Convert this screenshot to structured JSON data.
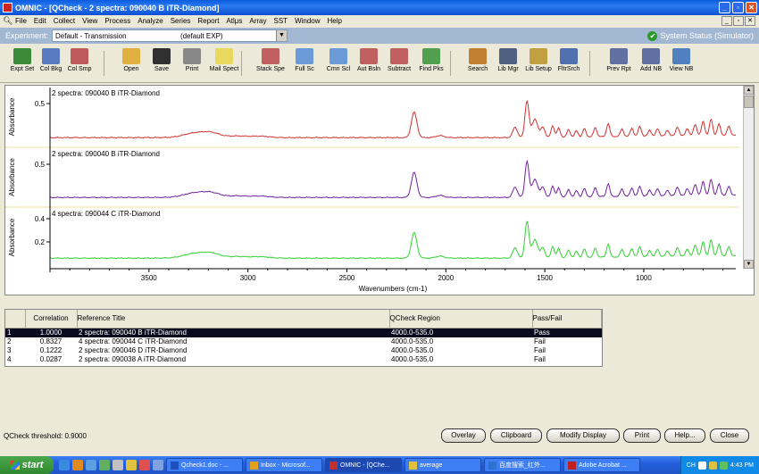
{
  "window": {
    "title": "OMNIC - [QCheck - 2 spectra: 090040 B   iTR-Diamond]",
    "controls": [
      "_",
      "▫",
      "✕"
    ]
  },
  "menu": {
    "items": [
      "File",
      "Edit",
      "Collect",
      "View",
      "Process",
      "Analyze",
      "Series",
      "Report",
      "Atlμs",
      "Array",
      "SST",
      "Window",
      "Help"
    ]
  },
  "experiment": {
    "label": "Experiment:",
    "selected": "Default - Transmission",
    "file": "(default EXP)",
    "status": "System Status (Simulator)",
    "status_color": "#2a9a2a"
  },
  "toolbar": [
    {
      "label": "Expt Set",
      "icon": "experiment-setup-icon",
      "color": "#3a8a3a"
    },
    {
      "label": "Col Bkg",
      "icon": "collect-background-icon",
      "color": "#5a7ac0"
    },
    {
      "label": "Col Smp",
      "icon": "collect-sample-icon",
      "color": "#c05a5a"
    },
    {
      "label": "Open",
      "icon": "open-folder-icon",
      "color": "#e0b040"
    },
    {
      "label": "Save",
      "icon": "save-disk-icon",
      "color": "#303030"
    },
    {
      "label": "Print",
      "icon": "printer-icon",
      "color": "#888888"
    },
    {
      "label": "Mail Spect",
      "icon": "mail-envelope-icon",
      "color": "#e8d860"
    },
    {
      "label": "Stack Spe",
      "icon": "stack-spectra-icon",
      "color": "#c06060"
    },
    {
      "label": "Full Sc",
      "icon": "full-scale-icon",
      "color": "#6a9ad8"
    },
    {
      "label": "Cmn Scl",
      "icon": "common-scale-icon",
      "color": "#6a9ad8"
    },
    {
      "label": "Aut Bsln",
      "icon": "auto-baseline-icon",
      "color": "#c06060"
    },
    {
      "label": "Subtract",
      "icon": "subtract-icon",
      "color": "#c06060"
    },
    {
      "label": "Find Pks",
      "icon": "find-peaks-icon",
      "color": "#50a050"
    },
    {
      "label": "Search",
      "icon": "search-magnifier-icon",
      "color": "#c08030"
    },
    {
      "label": "Lib Mgr",
      "icon": "library-manager-icon",
      "color": "#506080"
    },
    {
      "label": "Lib Setup",
      "icon": "library-setup-icon",
      "color": "#c0a040"
    },
    {
      "label": "FltrSrch",
      "icon": "filter-search-icon",
      "color": "#5070b0"
    },
    {
      "label": "Prev Rpt",
      "icon": "preview-report-icon",
      "color": "#6070a0"
    },
    {
      "label": "Add NB",
      "icon": "add-notebook-icon",
      "color": "#6070a0"
    },
    {
      "label": "View NB",
      "icon": "view-notebook-icon",
      "color": "#5080c0"
    }
  ],
  "spectra": {
    "y_label": "Absorbance",
    "x_label": "Wavenumbers (cm-1)",
    "x_ticks": [
      "3500",
      "3000",
      "2500",
      "2000",
      "1500",
      "1000"
    ],
    "traces": [
      {
        "label": "2 spectra: 090040 B   iTR-Diamond",
        "color": "#d03030",
        "y_ticks": [
          "0.5"
        ]
      },
      {
        "label": "2 spectra: 090040 B   iTR-Diamond",
        "color": "#7020a0",
        "y_ticks": [
          "0.5"
        ]
      },
      {
        "label": "4 spectra: 090044 C   iTR-Diamond",
        "color": "#30d030",
        "y_ticks": [
          "0.4",
          "0.2"
        ]
      }
    ]
  },
  "results": {
    "headers": [
      "Correlation",
      "Reference Title",
      "QCheck Region",
      "Pass/Fail"
    ],
    "rows": [
      {
        "idx": "1",
        "corr": "1.0000",
        "title": "2 spectra: 090040 B   iTR-Diamond",
        "region": "4000.0-535.0",
        "result": "Pass"
      },
      {
        "idx": "2",
        "corr": "0.8327",
        "title": "4 spectra: 090044 C   iTR-Diamond",
        "region": "4000.0-535.0",
        "result": "Fail"
      },
      {
        "idx": "3",
        "corr": "0.1222",
        "title": "2 spectra: 090046 D   iTR-Diamond",
        "region": "4000.0-535.0",
        "result": "Fail"
      },
      {
        "idx": "4",
        "corr": "0.0287",
        "title": "2 spectra: 090038 A   iTR-Diamond",
        "region": "4000.0-535.0",
        "result": "Fail"
      }
    ]
  },
  "threshold_text": "QCheck threshold:  0.9000",
  "buttons": {
    "overlay": "Overlay",
    "clipboard": "Clipboard",
    "modify": "Modify Display",
    "print": "Print",
    "help": "Help...",
    "close": "Close"
  },
  "taskbar": {
    "start": "start",
    "tasks": [
      {
        "label": "Qcheck1.doc - ...",
        "color": "#2050c0"
      },
      {
        "label": "Inbox - Microsof...",
        "color": "#e0a020"
      },
      {
        "label": "OMNIC - [QChe...",
        "color": "#c03030"
      },
      {
        "label": "average",
        "color": "#e0c040"
      },
      {
        "label": "百度搜索_红外...",
        "color": "#3070d0"
      },
      {
        "label": "Adobe Acrobat ...",
        "color": "#c02020"
      }
    ],
    "tray_lang": "CH",
    "clock": "4:43 PM"
  }
}
